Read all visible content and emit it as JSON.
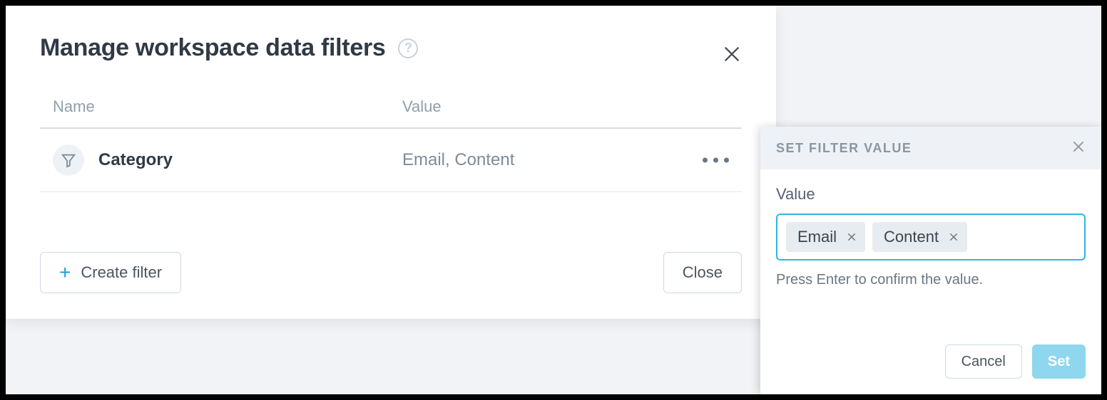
{
  "modal": {
    "title": "Manage workspace data filters",
    "columns": {
      "name": "Name",
      "value": "Value"
    },
    "rows": [
      {
        "name": "Category",
        "value": "Email, Content"
      }
    ],
    "create_label": "Create filter",
    "close_label": "Close"
  },
  "side": {
    "title": "SET FILTER VALUE",
    "value_label": "Value",
    "tags": [
      "Email",
      "Content"
    ],
    "hint": "Press Enter to confirm the value.",
    "cancel_label": "Cancel",
    "set_label": "Set"
  }
}
